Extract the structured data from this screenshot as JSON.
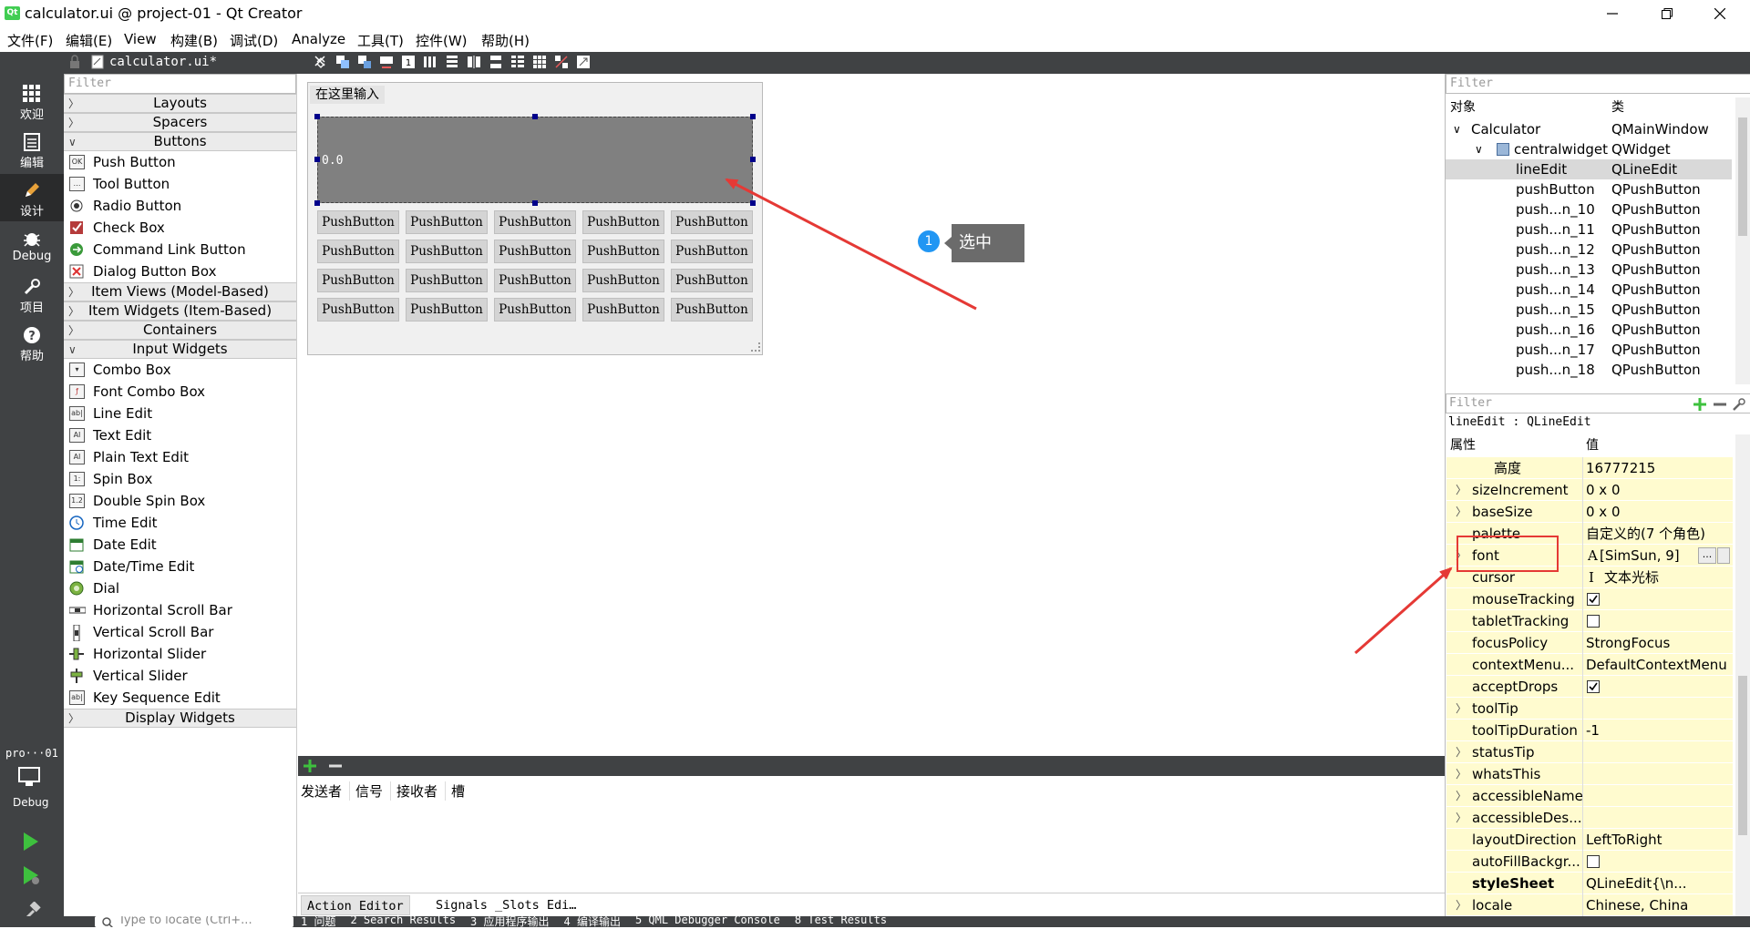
{
  "window": {
    "title": "calculator.ui @ project-01 - Qt Creator",
    "logo": "Qt"
  },
  "menu": [
    "文件(F)",
    "编辑(E)",
    "View",
    "构建(B)",
    "调试(D)",
    "Analyze",
    "工具(T)",
    "控件(W)",
    "帮助(H)"
  ],
  "modes": [
    {
      "label": "欢迎",
      "icon": "grid-icon"
    },
    {
      "label": "编辑",
      "icon": "document-icon"
    },
    {
      "label": "设计",
      "icon": "pencil-icon"
    },
    {
      "label": "Debug",
      "icon": "bug-icon"
    },
    {
      "label": "项目",
      "icon": "wrench-icon"
    },
    {
      "label": "帮助",
      "icon": "help-icon"
    }
  ],
  "kit": {
    "project": "pro···01",
    "label": "Debug"
  },
  "editor": {
    "file_tab": "calculator.ui*"
  },
  "widgetbox": {
    "filter_placeholder": "Filter",
    "categories": [
      "Layouts",
      "Spacers",
      "Buttons"
    ],
    "buttons": [
      "Push Button",
      "Tool Button",
      "Radio Button",
      "Check Box",
      "Command Link Button",
      "Dialog Button Box"
    ],
    "categories2": [
      "Item Views (Model-Based)",
      "Item Widgets (Item-Based)",
      "Containers",
      "Input Widgets"
    ],
    "inputs": [
      "Combo Box",
      "Font Combo Box",
      "Line Edit",
      "Text Edit",
      "Plain Text Edit",
      "Spin Box",
      "Double Spin Box",
      "Time Edit",
      "Date Edit",
      "Date/Time Edit",
      "Dial",
      "Horizontal Scroll Bar",
      "Vertical Scroll Bar",
      "Horizontal Slider",
      "Vertical Slider",
      "Key Sequence Edit"
    ],
    "categories3": [
      "Display Widgets"
    ]
  },
  "form": {
    "input_label": "在这里输入",
    "lineedit_value": "0.0",
    "button_label": "PushButton",
    "rows": 4,
    "cols": 5
  },
  "annotation": {
    "number": "1",
    "text": "选中"
  },
  "signals": {
    "headers": [
      "发送者",
      "信号",
      "接收者",
      "槽"
    ],
    "tabs": [
      "Action Editor",
      "Signals _Slots Edi…"
    ]
  },
  "bottom": {
    "locate_placeholder": "Type to locate (Ctrl+...",
    "items": [
      "1 问题",
      "2 Search Results",
      "3 应用程序输出",
      "4 编译输出",
      "5 QML Debugger Console",
      "8 Test Results"
    ]
  },
  "objects": {
    "filter_placeholder": "Filter",
    "headers": [
      "对象",
      "类"
    ],
    "rows": [
      {
        "name": "Calculator",
        "cls": "QMainWindow",
        "level": 0
      },
      {
        "name": "centralwidget",
        "cls": "QWidget",
        "level": 1
      },
      {
        "name": "lineEdit",
        "cls": "QLineEdit",
        "level": 2,
        "selected": true
      },
      {
        "name": "pushButton",
        "cls": "QPushButton",
        "level": 2
      },
      {
        "name": "push...n_10",
        "cls": "QPushButton",
        "level": 2
      },
      {
        "name": "push...n_11",
        "cls": "QPushButton",
        "level": 2
      },
      {
        "name": "push...n_12",
        "cls": "QPushButton",
        "level": 2
      },
      {
        "name": "push...n_13",
        "cls": "QPushButton",
        "level": 2
      },
      {
        "name": "push...n_14",
        "cls": "QPushButton",
        "level": 2
      },
      {
        "name": "push...n_15",
        "cls": "QPushButton",
        "level": 2
      },
      {
        "name": "push...n_16",
        "cls": "QPushButton",
        "level": 2
      },
      {
        "name": "push...n_17",
        "cls": "QPushButton",
        "level": 2
      },
      {
        "name": "push...n_18",
        "cls": "QPushButton",
        "level": 2
      }
    ]
  },
  "properties": {
    "filter_placeholder": "Filter",
    "selected": "lineEdit : QLineEdit",
    "headers": [
      "属性",
      "值"
    ],
    "rows": [
      {
        "name": "高度",
        "value": "16777215",
        "indent": true
      },
      {
        "name": "sizeIncrement",
        "value": "0 x 0",
        "exp": true
      },
      {
        "name": "baseSize",
        "value": "0 x 0",
        "exp": true
      },
      {
        "name": "palette",
        "value": "自定义的(7 个角色)"
      },
      {
        "name": "font",
        "value": "[SimSun, 9]",
        "exp": true,
        "font": true
      },
      {
        "name": "cursor",
        "value": "文本光标"
      },
      {
        "name": "mouseTracking",
        "check": true
      },
      {
        "name": "tabletTracking",
        "check": false
      },
      {
        "name": "focusPolicy",
        "value": "StrongFocus"
      },
      {
        "name": "contextMenu...",
        "value": "DefaultContextMenu"
      },
      {
        "name": "acceptDrops",
        "check": true
      },
      {
        "name": "toolTip",
        "value": "",
        "exp": true
      },
      {
        "name": "toolTipDuration",
        "value": "-1"
      },
      {
        "name": "statusTip",
        "value": "",
        "exp": true
      },
      {
        "name": "whatsThis",
        "value": "",
        "exp": true
      },
      {
        "name": "accessibleName",
        "value": "",
        "exp": true
      },
      {
        "name": "accessibleDes...",
        "value": "",
        "exp": true
      },
      {
        "name": "layoutDirection",
        "value": "LeftToRight"
      },
      {
        "name": "autoFillBackgr...",
        "check": false
      },
      {
        "name": "styleSheet",
        "value": "QLineEdit{\\n...",
        "bold": true
      },
      {
        "name": "locale",
        "value": "Chinese, China",
        "exp": true
      }
    ]
  },
  "colors": {
    "accent": "#e53935",
    "modebar": "#404244",
    "selected": "#d9d9d9",
    "prop_bg": "#fffbcf",
    "callout": "#6b6b6b",
    "badge": "#2196f3",
    "add": "#3ec13e"
  }
}
